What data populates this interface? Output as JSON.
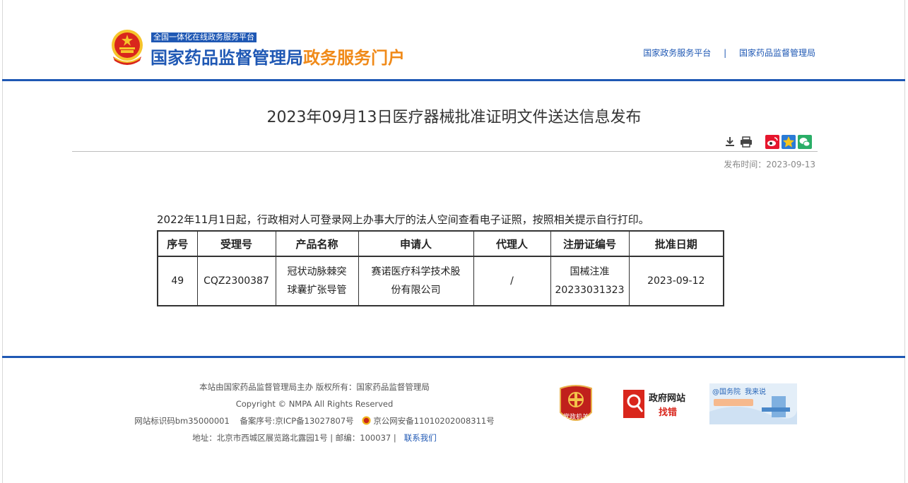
{
  "header": {
    "platform_tag": "全国一体化在线政务服务平台",
    "title_main": "国家药品监督管理局",
    "title_accent": "政务服务门户",
    "links": [
      "国家政务服务平台",
      "国家药品监督管理局"
    ],
    "link_separator": "|"
  },
  "article": {
    "title": "2023年09月13日医疗器械批准证明文件送达信息发布",
    "publish_label": "发布时间：",
    "publish_date": "2023-09-13",
    "notice": "2022年11月1日起，行政相对人可登录网上办事大厅的法人空间查看电子证照，按照相关提示自行打印。"
  },
  "tools": {
    "icons": [
      "download-icon",
      "print-icon",
      "weibo-share-icon",
      "qzone-share-icon",
      "wechat-share-icon"
    ]
  },
  "table": {
    "headers": [
      "序号",
      "受理号",
      "产品名称",
      "申请人",
      "代理人",
      "注册证编号",
      "批准日期"
    ],
    "rows": [
      {
        "seq": "49",
        "acceptance_no": "CQZ2300387",
        "product_line1": "冠状动脉棘突",
        "product_line2": "球囊扩张导管",
        "applicant_line1": "赛诺医疗科学技术股",
        "applicant_line2": "份有限公司",
        "agent": "/",
        "reg_line1": "国械注准",
        "reg_line2": "20233031323",
        "approval_date": "2023-09-12"
      }
    ]
  },
  "footer": {
    "line1": "本站由国家药品监督管理局主办 版权所有：国家药品监督管理局",
    "line2": "Copyright © NMPA All Rights Reserved",
    "site_code": "网站标识码bm35000001",
    "icp": "备案序号:京ICP备13027807号",
    "police": "京公网安备11010202008311号",
    "address": "地址：北京市西城区展览路北露园1号 | 邮编：100037 |",
    "contact": "联系我们",
    "badge_party": "党政机关",
    "badge_gov_line1": "政府网站",
    "badge_gov_line2": "找错",
    "badge_council_line1": "@国务院",
    "badge_council_line2": "我来说"
  },
  "colors": {
    "brand_blue": "#1f58b4",
    "brand_orange": "#f08a19",
    "emblem_red": "#d9261c",
    "emblem_gold": "#f6c52b"
  }
}
